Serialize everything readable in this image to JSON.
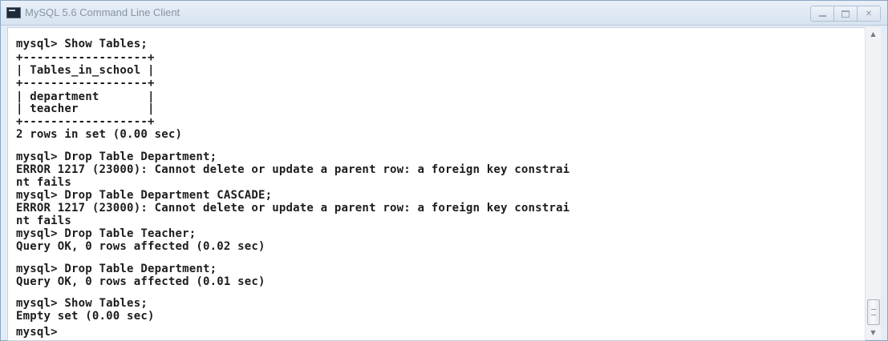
{
  "window": {
    "title": "MySQL 5.6 Command Line Client",
    "icon": "console-window-icon"
  },
  "console": {
    "lines": [
      "mysql> Show Tables;",
      "+------------------+",
      "| Tables_in_school |",
      "+------------------+",
      "| department       |",
      "| teacher          |",
      "+------------------+",
      "2 rows in set (0.00 sec)",
      "mysql> Drop Table Department;",
      "ERROR 1217 (23000): Cannot delete or update a parent row: a foreign key constrai",
      "nt fails",
      "mysql> Drop Table Department CASCADE;",
      "ERROR 1217 (23000): Cannot delete or update a parent row: a foreign key constrai",
      "nt fails",
      "mysql> Drop Table Teacher;",
      "Query OK, 0 rows affected (0.02 sec)",
      "mysql> Drop Table Department;",
      "Query OK, 0 rows affected (0.01 sec)",
      "mysql> Show Tables;",
      "Empty set (0.00 sec)",
      "mysql>"
    ]
  }
}
